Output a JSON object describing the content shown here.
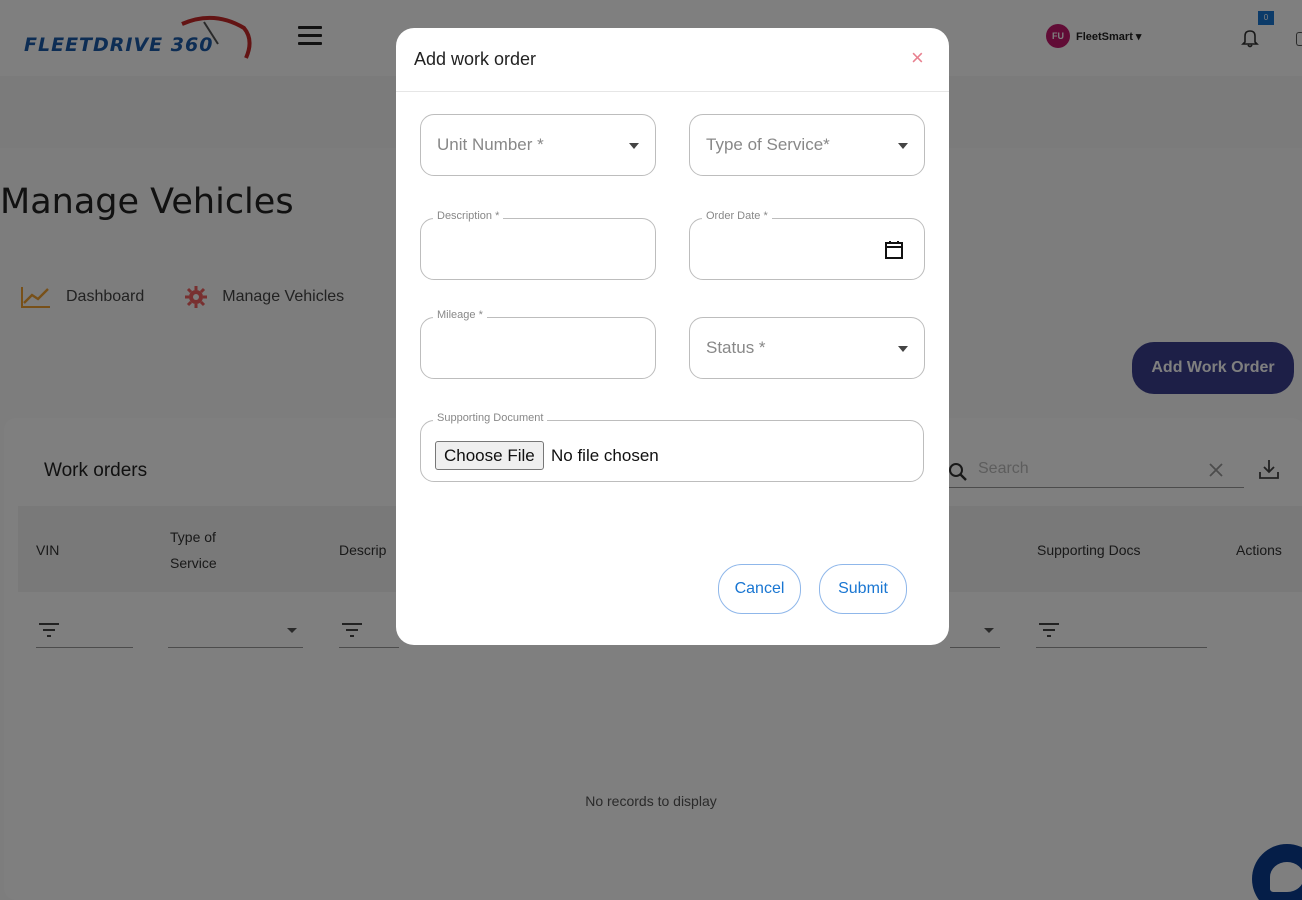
{
  "brand": {
    "logo_text": "FLEETDRIVE 360"
  },
  "topbar": {
    "avatar_initials": "FU",
    "account_name": "FleetSmart ▾",
    "notification_count": "0"
  },
  "page": {
    "title": "Manage Vehicles",
    "breadcrumbs": [
      {
        "label": "Dashboard",
        "icon": "chart-line-icon"
      },
      {
        "label": "Manage Vehicles",
        "icon": "gear-icon"
      }
    ],
    "add_button": "Add Work Order"
  },
  "table": {
    "title": "Work orders",
    "search_placeholder": "Search",
    "columns": [
      "VIN",
      "Type of Service",
      "Descrip",
      "Supporting Docs",
      "Actions"
    ],
    "empty_message": "No records to display"
  },
  "modal": {
    "title": "Add work order",
    "close_symbol": "×",
    "fields": {
      "unit_number": "Unit Number *",
      "type_of_service": "Type of Service*",
      "description": "Description *",
      "order_date": "Order Date *",
      "mileage": "Mileage *",
      "status": "Status *",
      "supporting_document": "Supporting Document"
    },
    "file_button": "Choose File",
    "file_status": "No file chosen",
    "cancel": "Cancel",
    "submit": "Submit"
  },
  "colors": {
    "primary": "#3a3f8f",
    "link_blue": "#1976d2",
    "brand_blue": "#1b5aa8",
    "accent_red": "#c62828"
  }
}
